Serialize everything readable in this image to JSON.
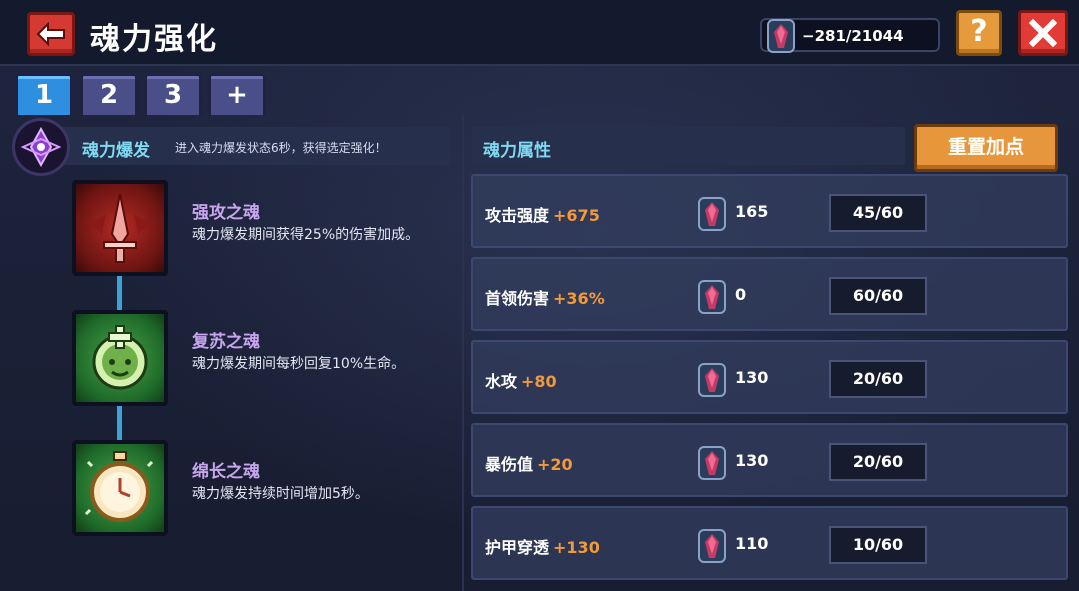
{
  "header": {
    "title": "魂力强化",
    "currency": "−281/21044",
    "help_label": "?"
  },
  "tabs": [
    {
      "label": "1",
      "active": true
    },
    {
      "label": "2",
      "active": false
    },
    {
      "label": "3",
      "active": false
    },
    {
      "label": "+",
      "active": false
    }
  ],
  "burst": {
    "title": "魂力爆发",
    "description": "进入魂力爆发状态6秒，获得选定强化！"
  },
  "souls": [
    {
      "name": "强攻之魂",
      "description": "魂力爆发期间获得25%的伤害加成。",
      "icon": "sword-icon",
      "color": "red"
    },
    {
      "name": "复苏之魂",
      "description": "魂力爆发期间每秒回复10%生命。",
      "icon": "heal-face-icon",
      "color": "green"
    },
    {
      "name": "绵长之魂",
      "description": "魂力爆发持续时间增加5秒。",
      "icon": "stopwatch-icon",
      "color": "green"
    }
  ],
  "attributes_panel": {
    "title": "魂力属性",
    "reset_label": "重置加点"
  },
  "attributes": [
    {
      "name": "攻击强度",
      "bonus": "+675",
      "cost": "165",
      "level": "45/60"
    },
    {
      "name": "首领伤害",
      "bonus": "+36%",
      "cost": "0",
      "level": "60/60"
    },
    {
      "name": "水攻",
      "bonus": "+80",
      "cost": "130",
      "level": "20/60"
    },
    {
      "name": "暴伤值",
      "bonus": "+20",
      "cost": "130",
      "level": "20/60"
    },
    {
      "name": "护甲穿透",
      "bonus": "+130",
      "cost": "110",
      "level": "10/60"
    }
  ],
  "colors": {
    "accent_cyan": "#7fd9f0",
    "bonus_orange": "#f29a3a",
    "soul_name_purple": "#c8a6ef",
    "active_tab_blue": "#2e8fe0"
  }
}
